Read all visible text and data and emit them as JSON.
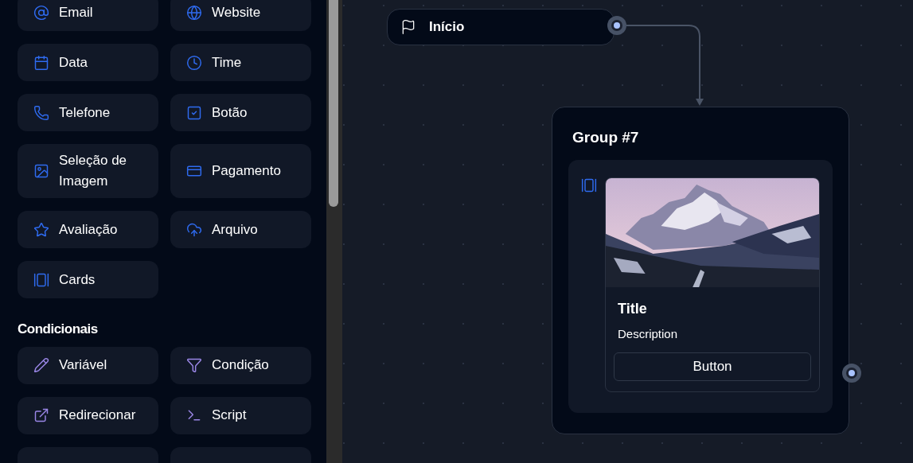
{
  "sidebar": {
    "sections": [
      {
        "kind": "input",
        "items": [
          {
            "label": "Email"
          },
          {
            "label": "Website"
          },
          {
            "label": "Data"
          },
          {
            "label": "Time"
          },
          {
            "label": "Telefone"
          },
          {
            "label": "Botão"
          },
          {
            "label": "Seleção de Imagem"
          },
          {
            "label": "Pagamento"
          },
          {
            "label": "Avaliação"
          },
          {
            "label": "Arquivo"
          },
          {
            "label": "Cards"
          }
        ]
      },
      {
        "kind": "logic",
        "title": "Condicionais",
        "items": [
          {
            "label": "Variável"
          },
          {
            "label": "Condição"
          },
          {
            "label": "Redirecionar"
          },
          {
            "label": "Script"
          }
        ]
      }
    ]
  },
  "canvas": {
    "start_node": {
      "label": "Início"
    },
    "group": {
      "title": "Group #7",
      "card": {
        "title": "Title",
        "description": "Description",
        "button": "Button"
      }
    }
  }
}
